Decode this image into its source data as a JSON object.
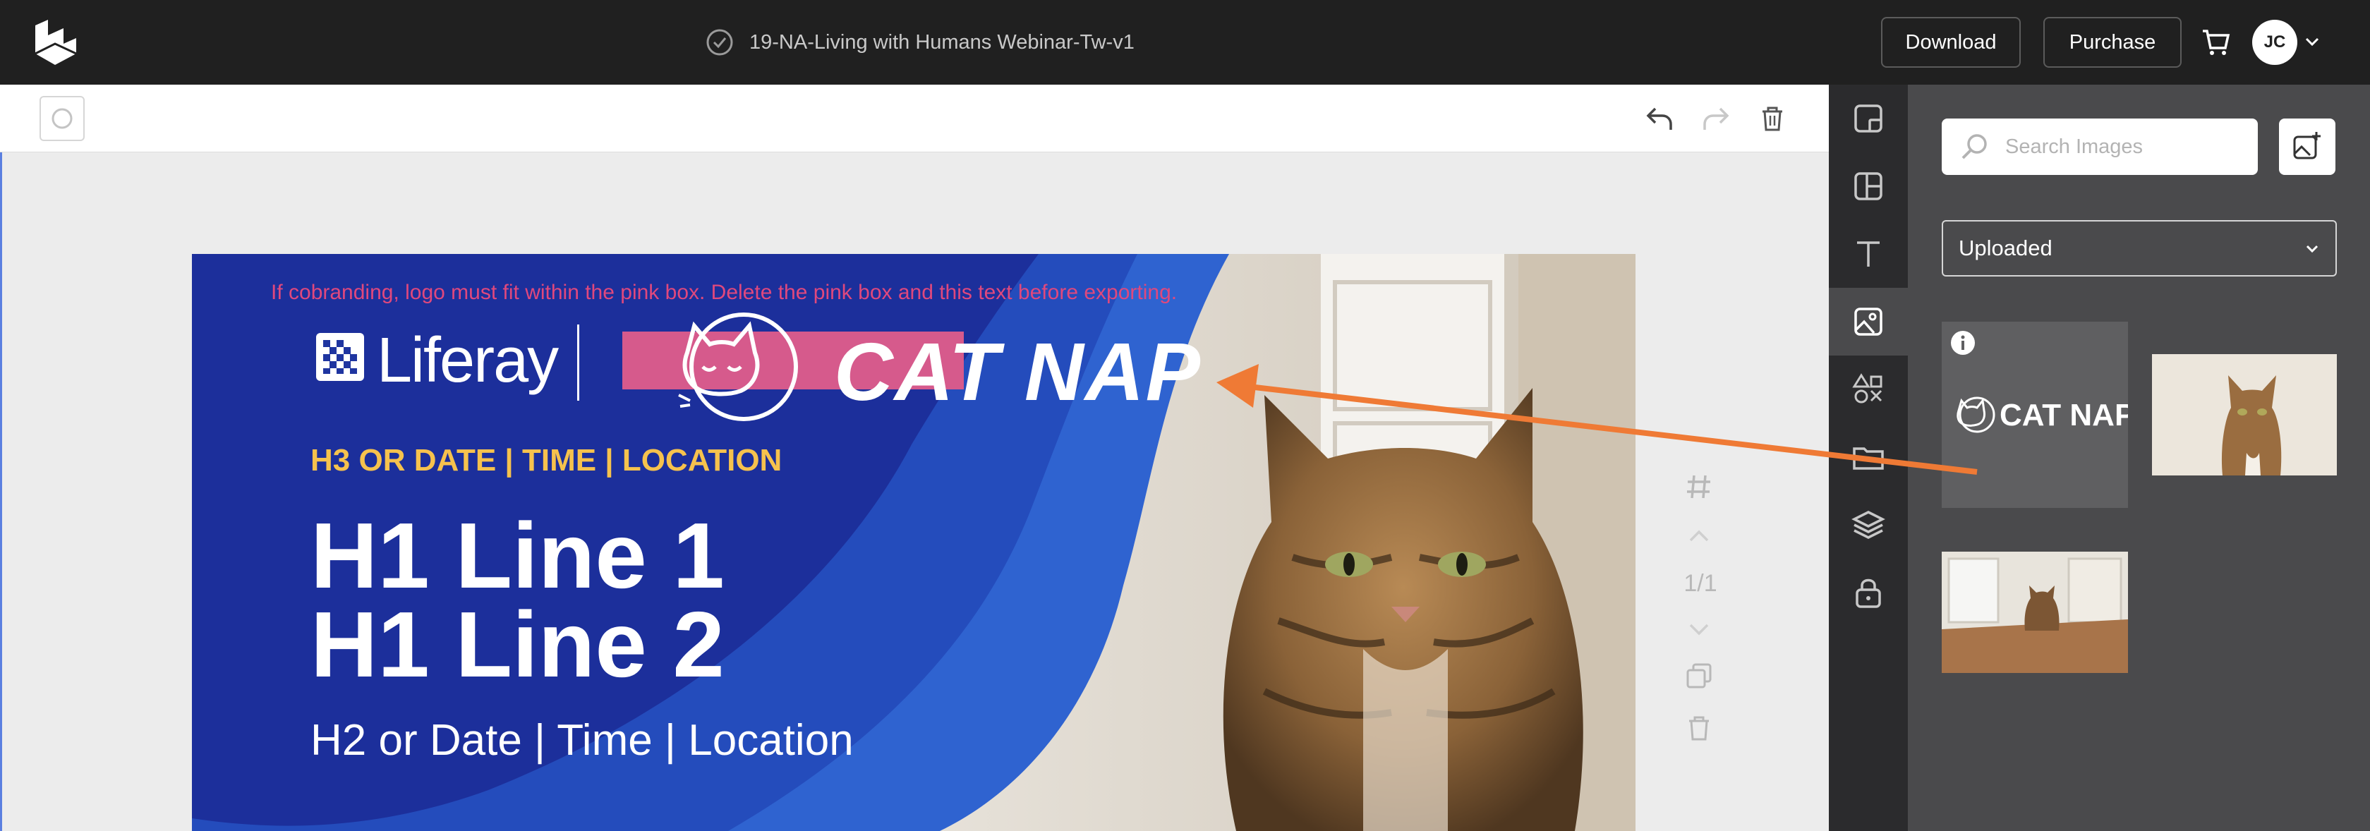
{
  "header": {
    "document_title": "19-NA-Living with Humans Webinar-Tw-v1",
    "download_label": "Download",
    "purchase_label": "Purchase",
    "avatar_initials": "JC"
  },
  "artboard": {
    "cobrand_note": "If cobranding, logo must fit within the pink box. Delete the pink box and this text before exporting.",
    "liferay_wordmark": "Liferay",
    "catnap_wordmark": "CAT NAP",
    "h3": "H3 OR DATE | TIME | LOCATION",
    "h1_line1": "H1 Line 1",
    "h1_line2": "H1 Line 2",
    "h2": "H2 or Date | Time | Location",
    "page_indicator": "1/1"
  },
  "panel": {
    "search_placeholder": "Search Images",
    "source_select": "Uploaded",
    "thumbnail_logo_text": "CAT NAP"
  },
  "colors": {
    "topbar": "#202020",
    "artboard_blue": "#1f35a0",
    "pink_box": "#d65a8c",
    "accent_yellow": "#f6c24d",
    "arrow": "#ef7a35",
    "panel": "#4a4a4c"
  },
  "icons": {
    "rail": [
      "frame-icon",
      "layout-icon",
      "text-icon",
      "image-icon",
      "elements-icon",
      "folder-icon",
      "layers-icon",
      "lock-icon"
    ],
    "toolbar": [
      "undo-icon",
      "redo-icon",
      "trash-icon"
    ]
  }
}
